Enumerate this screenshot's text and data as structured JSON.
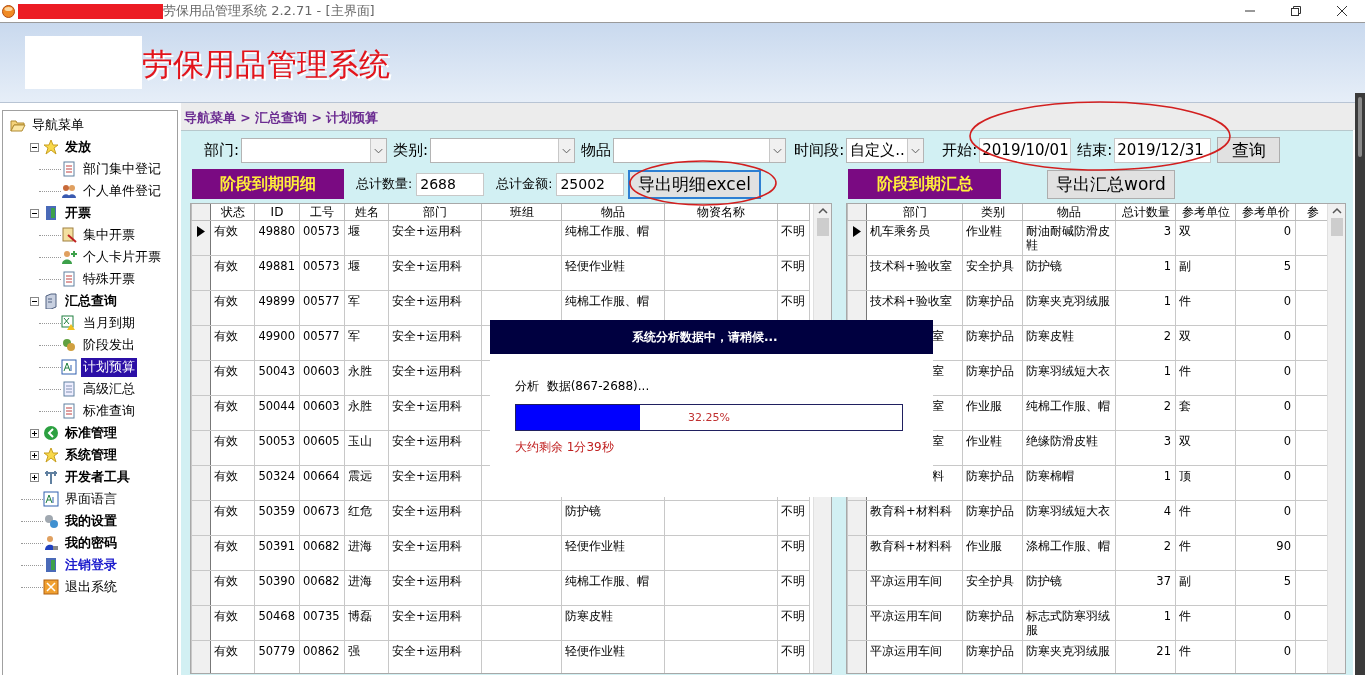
{
  "window": {
    "title": "劳保用品管理系统 2.2.71 - [主界面]"
  },
  "banner": {
    "title": "劳保用品管理系统"
  },
  "sidebar": {
    "items": [
      {
        "label": "导航菜单",
        "kind": "plain",
        "selected": false,
        "expanded": true,
        "children": [
          {
            "label": "发放",
            "kind": "bold",
            "selected": false,
            "expanded": true,
            "children": [
              {
                "label": "部门集中登记",
                "kind": "plain",
                "selected": false
              },
              {
                "label": "个人单件登记",
                "kind": "plain",
                "selected": false
              }
            ]
          },
          {
            "label": "开票",
            "kind": "bold",
            "selected": false,
            "expanded": true,
            "children": [
              {
                "label": "集中开票",
                "kind": "plain",
                "selected": false
              },
              {
                "label": "个人卡片开票",
                "kind": "plain",
                "selected": false
              },
              {
                "label": "特殊开票",
                "kind": "plain",
                "selected": false
              }
            ]
          },
          {
            "label": "汇总查询",
            "kind": "bold",
            "selected": false,
            "expanded": true,
            "children": [
              {
                "label": "当月到期",
                "kind": "plain",
                "selected": false
              },
              {
                "label": "阶段发出",
                "kind": "plain",
                "selected": false
              },
              {
                "label": "计划预算",
                "kind": "plain",
                "selected": true
              },
              {
                "label": "高级汇总",
                "kind": "plain",
                "selected": false
              },
              {
                "label": "标准查询",
                "kind": "plain",
                "selected": false
              }
            ]
          },
          {
            "label": "标准管理",
            "kind": "bold",
            "selected": false,
            "expanded": false
          },
          {
            "label": "系统管理",
            "kind": "bold",
            "selected": false,
            "expanded": false
          },
          {
            "label": "开发者工具",
            "kind": "bold",
            "selected": false,
            "expanded": false
          },
          {
            "label": "界面语言",
            "kind": "plain",
            "selected": false
          },
          {
            "label": "我的设置",
            "kind": "bold",
            "selected": false
          },
          {
            "label": "我的密码",
            "kind": "bold",
            "selected": false
          },
          {
            "label": "注销登录",
            "kind": "link",
            "selected": false
          },
          {
            "label": "退出系统",
            "kind": "plain",
            "selected": false
          }
        ]
      }
    ]
  },
  "breadcrumb": "导航菜单 > 汇总查询 > 计划预算",
  "filters": [
    {
      "label": "部门:",
      "kind": "select"
    },
    {
      "label": "类别:",
      "kind": "select"
    },
    {
      "label": "物品",
      "kind": "select"
    },
    {
      "label": "时间段:",
      "kind": "select",
      "value": "自定义.."
    },
    {
      "label": "开始:",
      "kind": "text",
      "value": "2019/10/01"
    },
    {
      "label": "结束:",
      "kind": "text",
      "value": "2019/12/31"
    }
  ],
  "query_button": "查询",
  "detail": {
    "title": "阶段到期明细",
    "total_qty_label": "总计数量:",
    "total_qty": "2688",
    "total_amount_label": "总计金额:",
    "total_amount": "25002",
    "export_button": "导出明细excel",
    "table": {
      "columns": [
        {
          "label": "状态",
          "kind": "text"
        },
        {
          "label": "ID",
          "kind": "number"
        },
        {
          "label": "工号",
          "kind": "text"
        },
        {
          "label": "姓名",
          "kind": "text"
        },
        {
          "label": "部门",
          "kind": "text"
        },
        {
          "label": "班组",
          "kind": "text"
        },
        {
          "label": "物品",
          "kind": "text"
        },
        {
          "label": "物资名称",
          "kind": "text"
        },
        {
          "kind": "text"
        }
      ],
      "rows": [
        {
          "current": true,
          "cells": [
            "有效",
            "49880",
            "00573",
            "堰",
            "安全+运用科",
            null,
            "纯棉工作服、帽",
            null,
            "不明"
          ]
        },
        {
          "current": false,
          "cells": [
            "有效",
            "49881",
            "00573",
            "堰",
            "安全+运用科",
            null,
            "轻便作业鞋",
            null,
            "不明"
          ]
        },
        {
          "current": false,
          "cells": [
            "有效",
            "49899",
            "00577",
            "军",
            "安全+运用科",
            null,
            "纯棉工作服、帽",
            null,
            "不明"
          ]
        },
        {
          "current": false,
          "cells": [
            "有效",
            "49900",
            "00577",
            "军",
            "安全+运用科"
          ]
        },
        {
          "current": false,
          "cells": [
            "有效",
            "50043",
            "00603",
            "永胜",
            "安全+运用科"
          ]
        },
        {
          "current": false,
          "cells": [
            "有效",
            "50044",
            "00603",
            "永胜",
            "安全+运用科"
          ]
        },
        {
          "current": false,
          "cells": [
            "有效",
            "50053",
            "00605",
            "玉山",
            "安全+运用科"
          ]
        },
        {
          "current": false,
          "cells": [
            "有效",
            "50324",
            "00664",
            "震远",
            "安全+运用科"
          ]
        },
        {
          "current": false,
          "cells": [
            "有效",
            "50359",
            "00673",
            "红危",
            "安全+运用科",
            null,
            "防护镜",
            null,
            "不明"
          ]
        },
        {
          "current": false,
          "cells": [
            "有效",
            "50391",
            "00682",
            "进海",
            "安全+运用科",
            null,
            "轻便作业鞋",
            null,
            "不明"
          ]
        },
        {
          "current": false,
          "cells": [
            "有效",
            "50390",
            "00682",
            "进海",
            "安全+运用科",
            null,
            "纯棉工作服、帽",
            null,
            "不明"
          ]
        },
        {
          "current": false,
          "cells": [
            "有效",
            "50468",
            "00735",
            "博磊",
            "安全+运用科",
            null,
            "防寒皮鞋",
            null,
            "不明"
          ]
        },
        {
          "current": false,
          "cells": [
            "有效",
            "50779",
            "00862",
            "强",
            "安全+运用科",
            null,
            "轻便作业鞋",
            null,
            "不明"
          ]
        }
      ]
    }
  },
  "summary": {
    "title": "阶段到期汇总",
    "export_button": "导出汇总word",
    "table": {
      "columns": [
        {
          "label": "部门",
          "kind": "text"
        },
        {
          "label": "类别",
          "kind": "text"
        },
        {
          "label": "物品",
          "kind": "text"
        },
        {
          "label": "总计数量",
          "kind": "number"
        },
        {
          "label": "参考单位",
          "kind": "text"
        },
        {
          "label": "参考单价",
          "kind": "number"
        },
        {
          "label": "参",
          "kind": "text"
        }
      ],
      "rows": [
        {
          "current": true,
          "covered": false,
          "cells": [
            "机车乘务员",
            "作业鞋",
            "耐油耐碱防滑皮鞋",
            "3",
            "双",
            "0"
          ]
        },
        {
          "current": false,
          "covered": false,
          "cells": [
            "技术科+验收室",
            "安全护具",
            "防护镜",
            "1",
            "副",
            "5"
          ]
        },
        {
          "current": false,
          "covered": false,
          "cells": [
            "技术科+验收室",
            "防寒护品",
            "防寒夹克羽绒服",
            "1",
            "件",
            "0"
          ]
        },
        {
          "current": false,
          "covered": true,
          "cells": [
            "室",
            "防寒护品",
            "防寒皮鞋",
            "2",
            "双",
            "0"
          ]
        },
        {
          "current": false,
          "covered": true,
          "cells": [
            "室",
            "防寒护品",
            "防寒羽绒短大衣",
            "1",
            "件",
            "0"
          ]
        },
        {
          "current": false,
          "covered": true,
          "cells": [
            "室",
            "作业服",
            "纯棉工作服、帽",
            "2",
            "套",
            "0"
          ]
        },
        {
          "current": false,
          "covered": true,
          "cells": [
            "室",
            "作业鞋",
            "绝缘防滑皮鞋",
            "3",
            "双",
            "0"
          ]
        },
        {
          "current": false,
          "covered": true,
          "cells": [
            "料",
            "防寒护品",
            "防寒棉帽",
            "1",
            "顶",
            "0"
          ]
        },
        {
          "current": false,
          "covered": false,
          "cells": [
            "教育科+材料科",
            "防寒护品",
            "防寒羽绒短大衣",
            "4",
            "件",
            "0"
          ]
        },
        {
          "current": false,
          "covered": false,
          "cells": [
            "教育科+材料科",
            "作业服",
            "涤棉工作服、帽",
            "2",
            "件",
            "90"
          ]
        },
        {
          "current": false,
          "covered": false,
          "cells": [
            "平凉运用车间",
            "安全护具",
            "防护镜",
            "37",
            "副",
            "5"
          ]
        },
        {
          "current": false,
          "covered": false,
          "cells": [
            "平凉运用车间",
            "防寒护品",
            "标志式防寒羽绒服",
            "1",
            "件",
            "0"
          ]
        },
        {
          "current": false,
          "covered": false,
          "cells": [
            "平凉运用车间",
            "防寒护品",
            "防寒夹克羽绒服",
            "21",
            "件",
            "0"
          ]
        }
      ]
    }
  },
  "progress_dialog": {
    "title": "系统分析数据中，请稍候...",
    "message": "分析  数据(867-2688)...",
    "level": 0.3225,
    "reading": "32.25%",
    "remaining": "大约剩余 1分39秒"
  }
}
